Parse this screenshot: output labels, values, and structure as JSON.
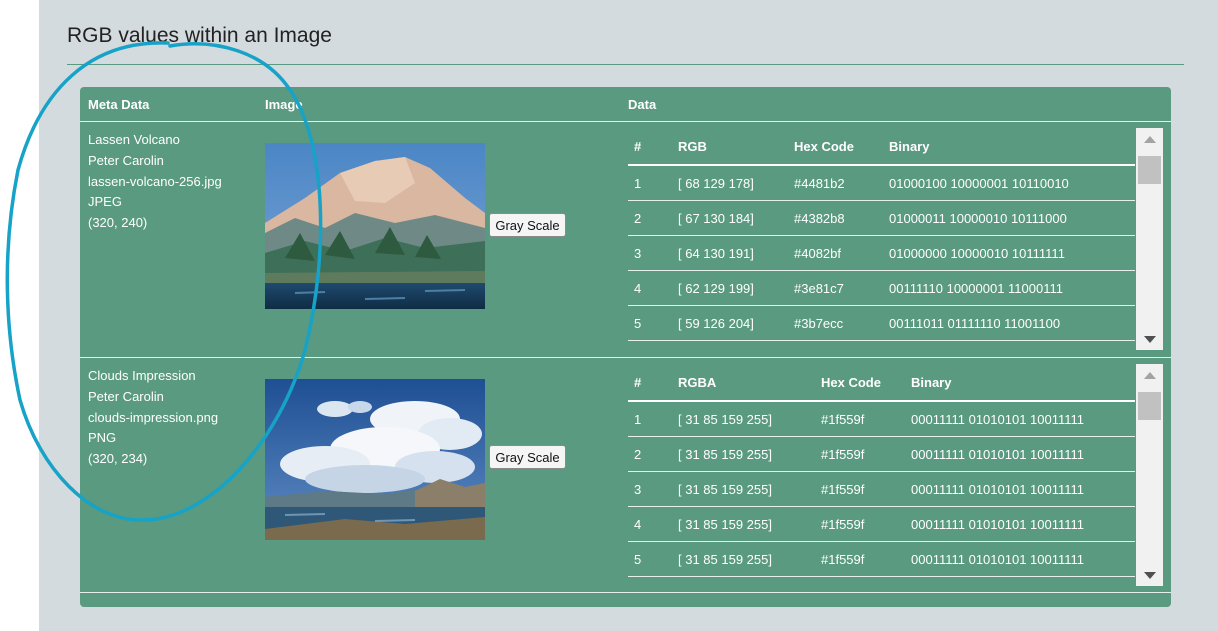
{
  "page": {
    "title": "RGB values within an Image"
  },
  "columns": {
    "meta": "Meta Data",
    "image": "Image",
    "data": "Data"
  },
  "colors": {
    "panel": "#d4dbdf",
    "card": "#5a9a80",
    "annotation": "#17a2c7"
  },
  "images": [
    {
      "meta": [
        "Lassen Volcano",
        "Peter Carolin",
        "lassen-volcano-256.jpg",
        "JPEG",
        "(320, 240)"
      ],
      "button": "Gray Scale",
      "headers": [
        "#",
        "RGB",
        "Hex Code",
        "Binary"
      ],
      "rows": [
        [
          "1",
          "[ 68 129 178]",
          "#4481b2",
          "01000100 10000001 10110010"
        ],
        [
          "2",
          "[ 67 130 184]",
          "#4382b8",
          "01000011 10000010 10111000"
        ],
        [
          "3",
          "[ 64 130 191]",
          "#4082bf",
          "01000000 10000010 10111111"
        ],
        [
          "4",
          "[ 62 129 199]",
          "#3e81c7",
          "00111110 10000001 11000111"
        ],
        [
          "5",
          "[ 59 126 204]",
          "#3b7ecc",
          "00111011 01111110 11001100"
        ]
      ]
    },
    {
      "meta": [
        "Clouds Impression",
        "Peter Carolin",
        "clouds-impression.png",
        "PNG",
        "(320, 234)"
      ],
      "button": "Gray Scale",
      "headers": [
        "#",
        "RGBA",
        "Hex Code",
        "Binary"
      ],
      "rows": [
        [
          "1",
          "[ 31 85 159 255]",
          "#1f559f",
          "00011111 01010101 10011111"
        ],
        [
          "2",
          "[ 31 85 159 255]",
          "#1f559f",
          "00011111 01010101 10011111"
        ],
        [
          "3",
          "[ 31 85 159 255]",
          "#1f559f",
          "00011111 01010101 10011111"
        ],
        [
          "4",
          "[ 31 85 159 255]",
          "#1f559f",
          "00011111 01010101 10011111"
        ],
        [
          "5",
          "[ 31 85 159 255]",
          "#1f559f",
          "00011111 01010101 10011111"
        ]
      ]
    }
  ]
}
